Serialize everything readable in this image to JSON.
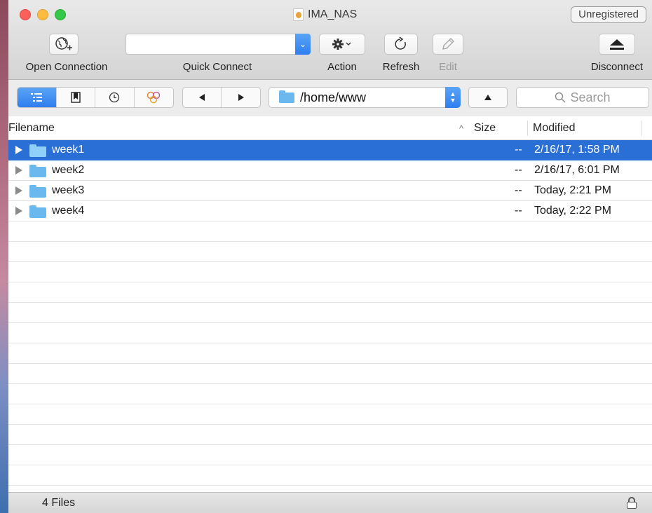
{
  "window": {
    "title": "IMA_NAS",
    "badge": "Unregistered"
  },
  "toolbar": {
    "open_connection_label": "Open Connection",
    "quick_connect_label": "Quick Connect",
    "quick_connect_value": "",
    "action_label": "Action",
    "refresh_label": "Refresh",
    "edit_label": "Edit",
    "disconnect_label": "Disconnect"
  },
  "navbar": {
    "path": "/home/www",
    "search_placeholder": "Search",
    "views": [
      "browser-icon",
      "bookmarks-icon",
      "history-icon",
      "bonjour-icon"
    ],
    "active_view": "browser-icon"
  },
  "table": {
    "columns": [
      "Filename",
      "Size",
      "Modified"
    ],
    "sort_indicator": "^",
    "rows": [
      {
        "name": "week1",
        "size": "--",
        "modified": "2/16/17, 1:58 PM",
        "selected": true
      },
      {
        "name": "week2",
        "size": "--",
        "modified": "2/16/17, 6:01 PM",
        "selected": false
      },
      {
        "name": "week3",
        "size": "--",
        "modified": "Today, 2:21 PM",
        "selected": false
      },
      {
        "name": "week4",
        "size": "--",
        "modified": "Today, 2:22 PM",
        "selected": false
      }
    ]
  },
  "status": {
    "count": "4 Files"
  },
  "colors": {
    "accent": "#2a6fd6",
    "folder": "#6ab8ee",
    "close": "#fc605b",
    "minimize": "#fdbc40",
    "zoom": "#34c84a"
  }
}
